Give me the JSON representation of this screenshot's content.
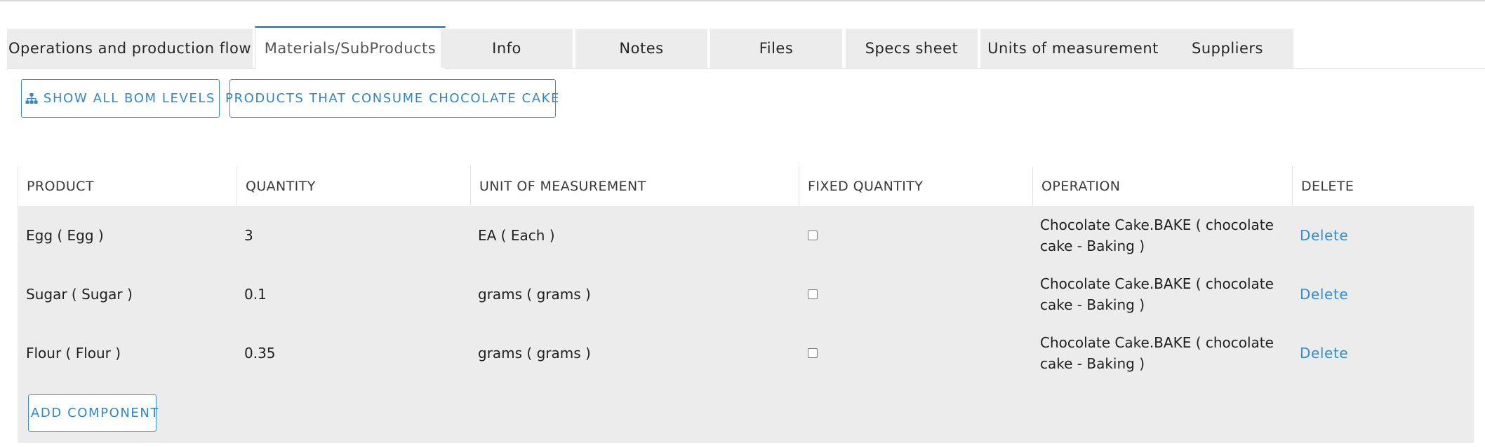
{
  "tabs": [
    {
      "label": "Operations and production flow",
      "active": false
    },
    {
      "label": "Materials/SubProducts",
      "active": true
    },
    {
      "label": "Info",
      "active": false
    },
    {
      "label": "Notes",
      "active": false
    },
    {
      "label": "Files",
      "active": false
    },
    {
      "label": "Specs sheet",
      "active": false
    },
    {
      "label": "Units of measurement",
      "active": false
    },
    {
      "label": "Suppliers",
      "active": false
    }
  ],
  "actions": {
    "show_bom_label": "SHOW ALL BOM LEVELS",
    "show_bom_icon": "sitemap-icon",
    "consumers_label": "PRODUCTS THAT CONSUME CHOCOLATE CAKE",
    "add_component_label": "ADD COMPONENT",
    "add_component_icon": "plus-icon"
  },
  "table": {
    "headers": [
      "PRODUCT",
      "QUANTITY",
      "UNIT OF MEASUREMENT",
      "FIXED QUANTITY",
      "OPERATION",
      "DELETE"
    ],
    "rows": [
      {
        "product": "Egg ( Egg )",
        "quantity": "3",
        "unit": "EA ( Each )",
        "fixed": false,
        "operation": "Chocolate Cake.BAKE ( chocolate cake - Baking )",
        "delete": "Delete"
      },
      {
        "product": "Sugar ( Sugar )",
        "quantity": "0.1",
        "unit": "grams ( grams )",
        "fixed": false,
        "operation": "Chocolate Cake.BAKE ( chocolate cake - Baking )",
        "delete": "Delete"
      },
      {
        "product": "Flour ( Flour )",
        "quantity": "0.35",
        "unit": "grams ( grams )",
        "fixed": false,
        "operation": "Chocolate Cake.BAKE ( chocolate cake - Baking )",
        "delete": "Delete"
      }
    ]
  },
  "colors": {
    "accent": "#2f8fd1",
    "tab_bg": "#ececec",
    "row_bg": "#ececec"
  }
}
